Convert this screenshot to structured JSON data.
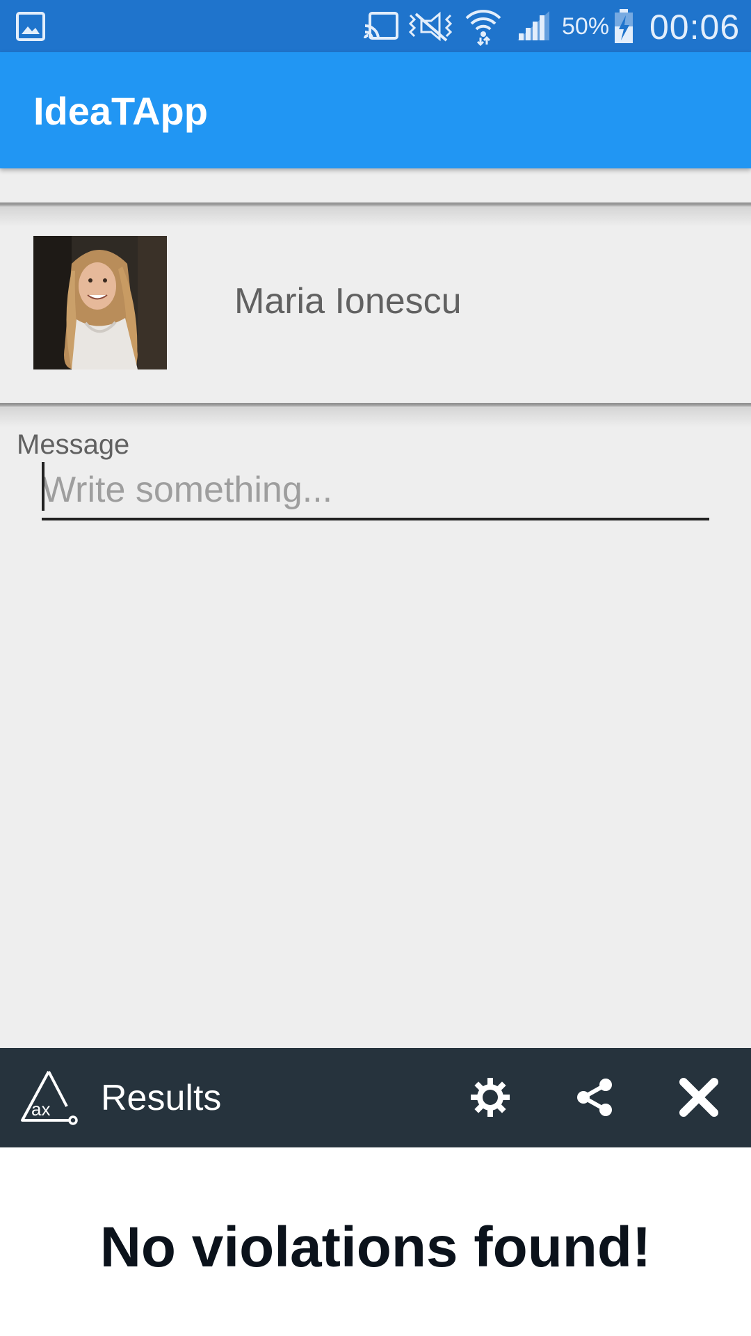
{
  "status_bar": {
    "battery_percent": "50%",
    "time": "00:06",
    "icons": [
      "gallery-icon",
      "cast-icon",
      "vibrate-icon",
      "wifi-icon",
      "signal-icon",
      "battery-charging-icon"
    ]
  },
  "app_bar": {
    "title": "IdeaTApp",
    "color": "#2196f3"
  },
  "contact": {
    "name": "Maria Ionescu"
  },
  "message": {
    "label": "Message",
    "placeholder": "Write something...",
    "value": ""
  },
  "results_bar": {
    "title": "Results",
    "buttons": [
      "settings-icon",
      "share-icon",
      "close-icon"
    ],
    "color": "#26333d"
  },
  "results_panel": {
    "message": "No violations found!"
  }
}
